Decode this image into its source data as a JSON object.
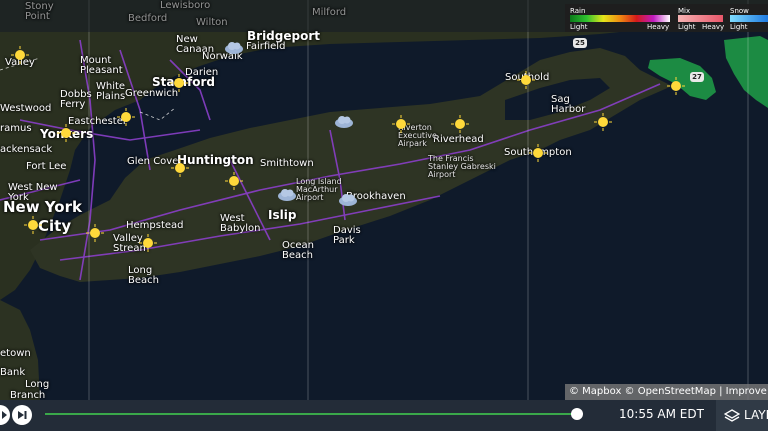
{
  "map": {
    "labels": {
      "stony_point": "Stony\nPoint",
      "bedford": "Bedford",
      "lewisboro": "Lewisboro",
      "wilton": "Wilton",
      "milford": "Milford",
      "bridgeport": "Bridgeport",
      "fairfield": "Fairfield",
      "new_canaan": "New\nCanaan",
      "norwalk": "Norwalk",
      "valley": "Valley",
      "mount_pleasant": "Mount\nPleasant",
      "stamford": "Stamford",
      "darien": "Darien",
      "dobbs_ferry": "Dobbs\nFerry",
      "white_plains": "White\nPlains",
      "greenwich": "Greenwich",
      "westwood": "Westwood",
      "eastchester": "Eastchester",
      "ramus": "ramus",
      "yonkers": "Yonkers",
      "hackensack": "ackensack",
      "fort_lee": "Fort Lee",
      "glen_cove": "Glen Cove",
      "huntington": "Huntington",
      "smithtown": "Smithtown",
      "west_new_york": "West New\nYork",
      "new_york": "New York",
      "city": "City",
      "hempstead": "Hempstead",
      "valley_stream": "Valley\nStream",
      "west_babylon": "West\nBabylon",
      "islip": "Islip",
      "long_island_macarthur_airport": "Long Island\nMacArthur\nAirport",
      "brookhaven": "Brookhaven",
      "ocean_beach": "Ocean\nBeach",
      "davis_park": "Davis\nPark",
      "long_beach": "Long\nBeach",
      "riverhead": "Riverhead",
      "riverton_executive_airpark": "Riverton\nExecutive\nAirpark",
      "francis_gabreski_airport": "The Francis\nStanley Gabreski\nAirport",
      "southold": "Southold",
      "sag_harbor": "Sag\nHarbor",
      "southampton": "Southampton",
      "hinetown": "etown",
      "bank": "Bank",
      "long": "Long",
      "branch": "Branch"
    },
    "route_shields": {
      "r25": "25",
      "r27": "27"
    }
  },
  "legend": {
    "rain": {
      "title": "Rain",
      "low": "Light",
      "high": "Heavy"
    },
    "mix": {
      "title": "Mix",
      "low": "Light",
      "high": "Heavy"
    },
    "snow": {
      "title": "Snow",
      "low": "Light"
    }
  },
  "attribution": "© Mapbox © OpenStreetMap | Improve this map",
  "player": {
    "time": "10:55 AM EDT",
    "progress": 0.95,
    "layers_label": "LAYERS"
  },
  "icons": {
    "play": "play-icon",
    "skip": "skip-forward-icon",
    "layers": "layers-icon",
    "sunny": "sunny-icon",
    "cloudy": "cloud-icon"
  },
  "colors": {
    "water": "#0d1726",
    "land": "#2b3122",
    "roads": "#8a3fc9",
    "progress": "#3aa84a",
    "radar": "#22b14c"
  }
}
